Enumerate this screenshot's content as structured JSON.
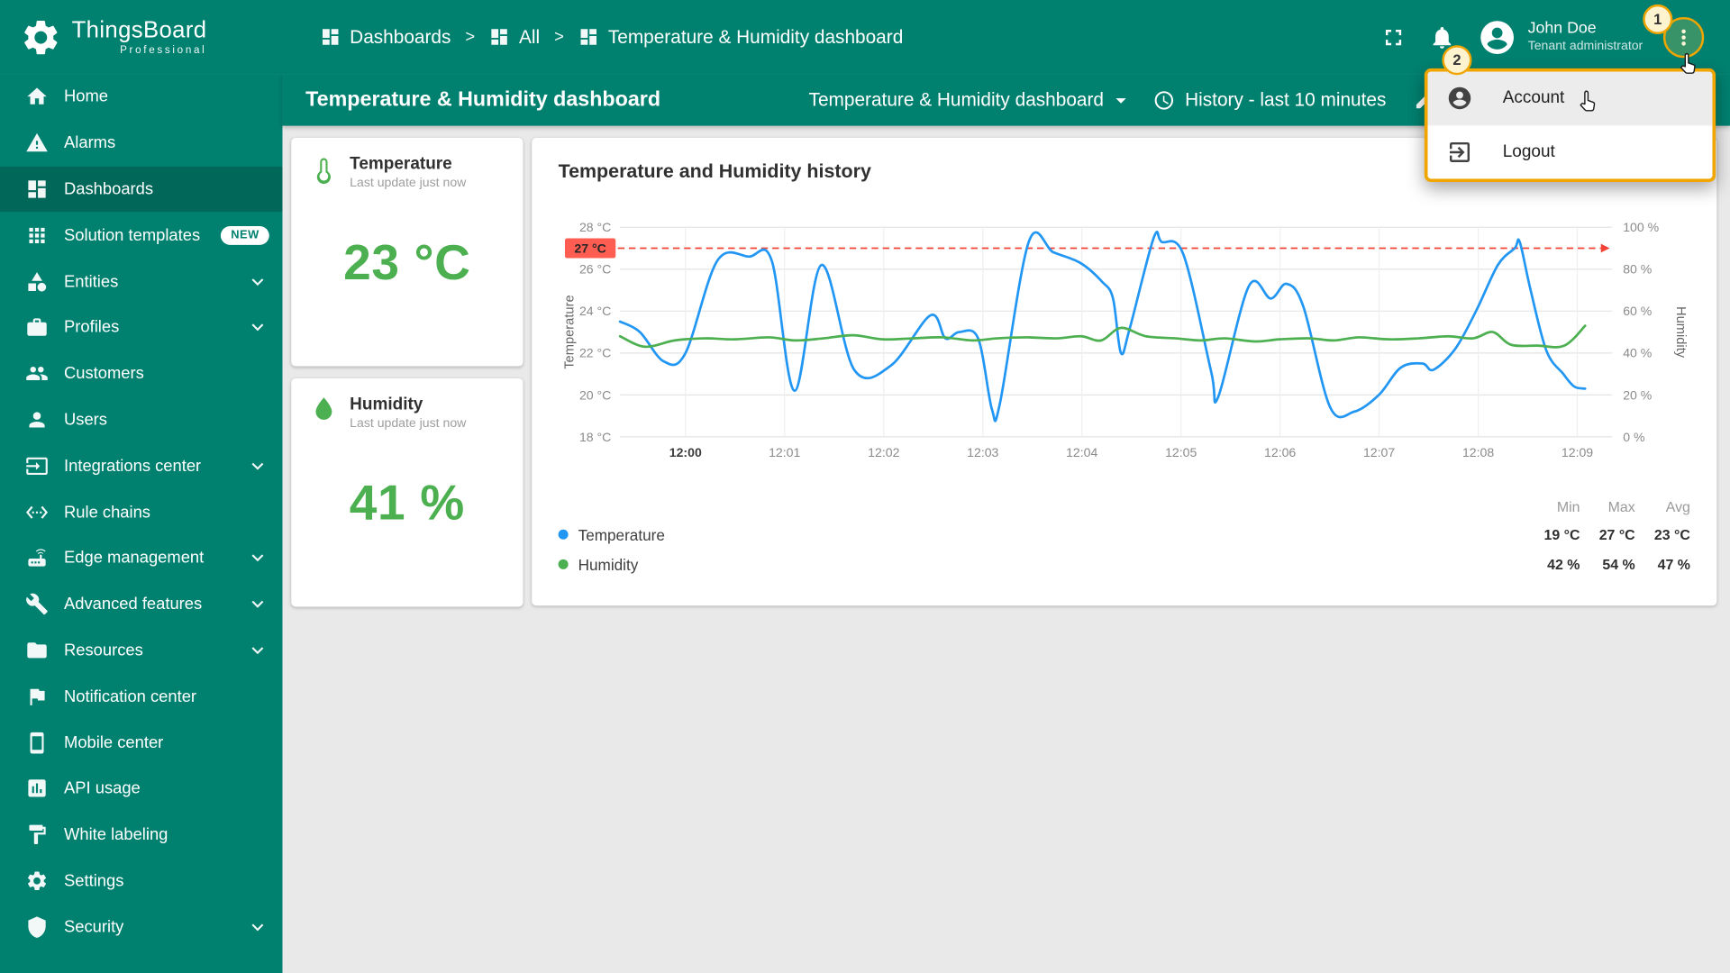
{
  "topbar": {
    "logo_title": "ThingsBoard",
    "logo_subtitle": "Professional",
    "breadcrumb": [
      {
        "label": "Dashboards",
        "icon": "dashboard"
      },
      {
        "label": "All",
        "icon": "dashboard"
      },
      {
        "label": "Temperature & Humidity dashboard",
        "icon": "dashboard"
      }
    ],
    "user_name": "John Doe",
    "user_role": "Tenant administrator"
  },
  "toolbar": {
    "title": "Temperature & Humidity dashboard",
    "state_label": "Temperature & Humidity dashboard",
    "history_label": "History - last 10 minutes"
  },
  "sidebar": {
    "items": [
      {
        "label": "Home",
        "icon": "home"
      },
      {
        "label": "Alarms",
        "icon": "alarms"
      },
      {
        "label": "Dashboards",
        "icon": "dashboards",
        "active": true
      },
      {
        "label": "Solution templates",
        "icon": "solution-templates",
        "badge": "NEW"
      },
      {
        "label": "Entities",
        "icon": "entities",
        "expandable": true
      },
      {
        "label": "Profiles",
        "icon": "profiles",
        "expandable": true
      },
      {
        "label": "Customers",
        "icon": "customers"
      },
      {
        "label": "Users",
        "icon": "users"
      },
      {
        "label": "Integrations center",
        "icon": "integrations",
        "expandable": true
      },
      {
        "label": "Rule chains",
        "icon": "rule-chains"
      },
      {
        "label": "Edge management",
        "icon": "edge",
        "expandable": true
      },
      {
        "label": "Advanced features",
        "icon": "advanced",
        "expandable": true
      },
      {
        "label": "Resources",
        "icon": "resources",
        "expandable": true
      },
      {
        "label": "Notification center",
        "icon": "notification"
      },
      {
        "label": "Mobile center",
        "icon": "mobile"
      },
      {
        "label": "API usage",
        "icon": "api"
      },
      {
        "label": "White labeling",
        "icon": "white-labeling"
      },
      {
        "label": "Settings",
        "icon": "settings"
      },
      {
        "label": "Security",
        "icon": "security",
        "expandable": true
      }
    ]
  },
  "user_menu": {
    "items": [
      {
        "label": "Account",
        "icon": "account",
        "highlighted": true
      },
      {
        "label": "Logout",
        "icon": "logout"
      }
    ]
  },
  "annotations": {
    "step1": "1",
    "step2": "2"
  },
  "icons": {
    "logo": "gear",
    "fullscreen": "fullscreen",
    "notifications": "bell",
    "avatar": "account-circle",
    "menu": "more-vert",
    "state_caret": "caret-down",
    "clock": "clock",
    "edit": "pencil",
    "temperature": "thermometer",
    "humidity": "droplet"
  },
  "widgets": {
    "temperature": {
      "title": "Temperature",
      "subtitle": "Last update just now",
      "value": "23 °C",
      "color": "#4caf50"
    },
    "humidity": {
      "title": "Humidity",
      "subtitle": "Last update just now",
      "value": "41 %",
      "color": "#4caf50"
    }
  },
  "chart_data": {
    "type": "line",
    "title": "Temperature and Humidity history",
    "x_ticks": [
      "12:00",
      "12:01",
      "12:02",
      "12:03",
      "12:04",
      "12:05",
      "12:06",
      "12:07",
      "12:08",
      "12:09"
    ],
    "left_axis": {
      "label": "Temperature",
      "min": 18,
      "max": 28,
      "ticks": [
        "18 °C",
        "20 °C",
        "22 °C",
        "24 °C",
        "26 °C",
        "28 °C"
      ]
    },
    "right_axis": {
      "label": "Humidity",
      "min": 0,
      "max": 100,
      "ticks": [
        "0 %",
        "20 %",
        "40 %",
        "60 %",
        "80 %",
        "100 %"
      ]
    },
    "threshold": {
      "value": 27,
      "label": "27 °C",
      "color": "#f44336"
    },
    "grid": true,
    "legend_position": "bottom-left",
    "series": [
      {
        "name": "Temperature",
        "color": "#2196f3",
        "axis": "left",
        "points": [
          [
            0.0,
            23.5
          ],
          [
            0.02,
            23.0
          ],
          [
            0.044,
            21.6
          ],
          [
            0.066,
            22.0
          ],
          [
            0.098,
            26.4
          ],
          [
            0.13,
            26.6
          ],
          [
            0.153,
            26.4
          ],
          [
            0.176,
            20.2
          ],
          [
            0.203,
            26.2
          ],
          [
            0.236,
            21.2
          ],
          [
            0.273,
            21.4
          ],
          [
            0.313,
            23.8
          ],
          [
            0.328,
            22.7
          ],
          [
            0.342,
            23.0
          ],
          [
            0.361,
            22.7
          ],
          [
            0.375,
            19.3
          ],
          [
            0.383,
            19.6
          ],
          [
            0.412,
            27.3
          ],
          [
            0.437,
            26.8
          ],
          [
            0.464,
            26.3
          ],
          [
            0.486,
            25.4
          ],
          [
            0.497,
            24.6
          ],
          [
            0.505,
            22.0
          ],
          [
            0.514,
            23.2
          ],
          [
            0.538,
            27.5
          ],
          [
            0.546,
            27.3
          ],
          [
            0.568,
            26.7
          ],
          [
            0.596,
            21.1
          ],
          [
            0.603,
            19.9
          ],
          [
            0.634,
            25.2
          ],
          [
            0.656,
            24.6
          ],
          [
            0.672,
            25.3
          ],
          [
            0.689,
            24.2
          ],
          [
            0.716,
            19.4
          ],
          [
            0.74,
            19.2
          ],
          [
            0.765,
            20.0
          ],
          [
            0.787,
            21.3
          ],
          [
            0.809,
            21.5
          ],
          [
            0.82,
            21.2
          ],
          [
            0.842,
            22.2
          ],
          [
            0.863,
            24.0
          ],
          [
            0.885,
            26.2
          ],
          [
            0.902,
            27.0
          ],
          [
            0.907,
            27.3
          ],
          [
            0.918,
            25.0
          ],
          [
            0.934,
            22.1
          ],
          [
            0.951,
            21.0
          ],
          [
            0.962,
            20.4
          ],
          [
            0.973,
            20.3
          ]
        ]
      },
      {
        "name": "Humidity",
        "color": "#4caf50",
        "axis": "right",
        "points": [
          [
            0.0,
            48
          ],
          [
            0.025,
            43
          ],
          [
            0.055,
            46
          ],
          [
            0.085,
            47
          ],
          [
            0.115,
            46.5
          ],
          [
            0.15,
            47.5
          ],
          [
            0.176,
            46
          ],
          [
            0.205,
            47
          ],
          [
            0.235,
            48.5
          ],
          [
            0.265,
            46.5
          ],
          [
            0.295,
            47
          ],
          [
            0.325,
            47.5
          ],
          [
            0.355,
            46
          ],
          [
            0.38,
            47
          ],
          [
            0.41,
            47.5
          ],
          [
            0.44,
            47
          ],
          [
            0.465,
            48
          ],
          [
            0.485,
            46
          ],
          [
            0.505,
            52
          ],
          [
            0.53,
            48
          ],
          [
            0.56,
            47
          ],
          [
            0.585,
            46
          ],
          [
            0.61,
            47
          ],
          [
            0.64,
            45.5
          ],
          [
            0.665,
            46.5
          ],
          [
            0.695,
            47
          ],
          [
            0.72,
            46
          ],
          [
            0.745,
            47.5
          ],
          [
            0.775,
            46.5
          ],
          [
            0.805,
            47
          ],
          [
            0.835,
            48
          ],
          [
            0.86,
            47
          ],
          [
            0.88,
            50
          ],
          [
            0.898,
            44
          ],
          [
            0.925,
            43.5
          ],
          [
            0.952,
            43.5
          ],
          [
            0.973,
            53
          ]
        ]
      }
    ],
    "legend": [
      {
        "name": "Temperature",
        "color": "#2196f3"
      },
      {
        "name": "Humidity",
        "color": "#4caf50"
      }
    ],
    "summary": {
      "headers": [
        "Min",
        "Max",
        "Avg"
      ],
      "rows": [
        {
          "name": "Temperature",
          "values": [
            "19 °C",
            "27 °C",
            "23 °C"
          ]
        },
        {
          "name": "Humidity",
          "values": [
            "42 %",
            "54 %",
            "47 %"
          ]
        }
      ]
    }
  }
}
